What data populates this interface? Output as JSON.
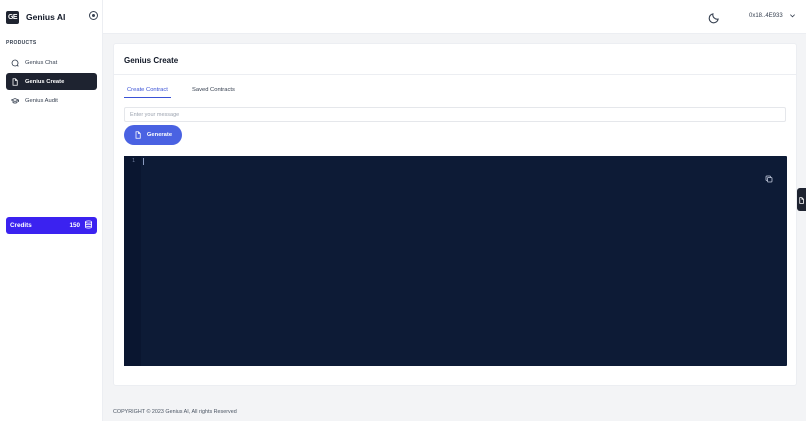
{
  "app": {
    "brand_logo_text": "GE",
    "brand_name": "Genius AI"
  },
  "sidebar": {
    "section_label": "PRODUCTS",
    "items": [
      {
        "label": "Genius Chat",
        "icon": "chat-icon",
        "active": false
      },
      {
        "label": "Genius Create",
        "icon": "document-icon",
        "active": true
      },
      {
        "label": "Genius Audit",
        "icon": "audit-icon",
        "active": false
      }
    ],
    "credits": {
      "label": "Credits",
      "value": "150",
      "icon": "database-icon"
    }
  },
  "header": {
    "theme_icon": "moon-icon",
    "wallet_address": "0x18..4E933",
    "wallet_chevron": "chevron-down-icon"
  },
  "main": {
    "title": "Genius Create",
    "tabs": [
      {
        "label": "Create Contract",
        "active": true
      },
      {
        "label": "Saved Contracts",
        "active": false
      }
    ],
    "message_input": {
      "placeholder": "Enter your message",
      "value": ""
    },
    "generate_label": "Generate",
    "editor": {
      "line_number": "1",
      "copy_icon": "copy-icon"
    }
  },
  "footer": {
    "copyright": "COPYRIGHT © 2023 Genius AI, All rights Reserved"
  },
  "colors": {
    "accent": "#3a52d6",
    "generate_button": "#4a62e2",
    "credits_bg": "#3b22f0",
    "active_nav_bg": "#1e2330",
    "editor_bg": "#0d1b36"
  }
}
